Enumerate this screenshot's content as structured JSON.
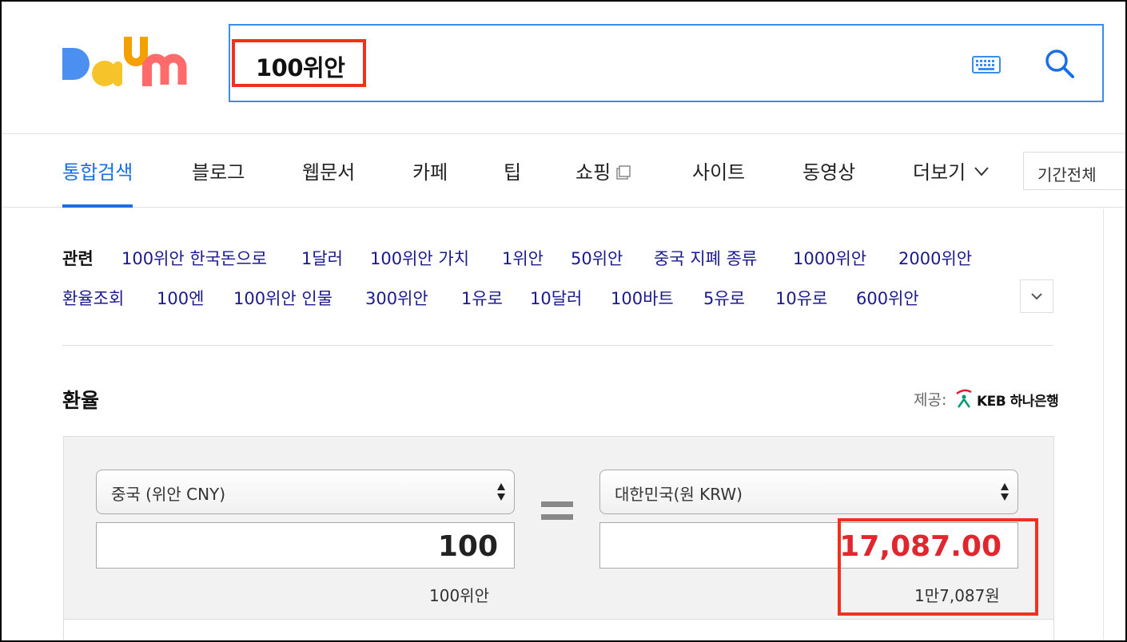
{
  "search": {
    "query": "100위안"
  },
  "tabs": [
    {
      "label": "통합검색"
    },
    {
      "label": "블로그"
    },
    {
      "label": "웹문서"
    },
    {
      "label": "카페"
    },
    {
      "label": "팁"
    },
    {
      "label": "쇼핑"
    },
    {
      "label": "사이트"
    },
    {
      "label": "동영상"
    },
    {
      "label": "더보기"
    }
  ],
  "period": "기간전체",
  "related": {
    "label": "관련",
    "row1": [
      "100위안 한국돈으로",
      "1달러",
      "100위안 가치",
      "1위안",
      "50위안",
      "중국 지폐 종류",
      "1000위안",
      "2000위안"
    ],
    "row2": [
      "환율조회",
      "100엔",
      "100위안 인물",
      "300위안",
      "1유로",
      "10달러",
      "100바트",
      "5유로",
      "10유로",
      "600위안"
    ]
  },
  "exchange": {
    "title": "환율",
    "provider_label": "제공:",
    "provider_name": "KEB 하나은행",
    "from_currency": "중국 (위안 CNY)",
    "to_currency": "대한민국(원 KRW)",
    "from_amount": "100",
    "to_amount": "17,087.00",
    "from_text": "100위안",
    "to_text": "1만7,087원"
  },
  "colors": {
    "accent": "#1a6ee6",
    "search_border": "#3b8ded",
    "link": "#1a1a8c",
    "result": "#e0262f",
    "highlight": "#f2301b"
  }
}
